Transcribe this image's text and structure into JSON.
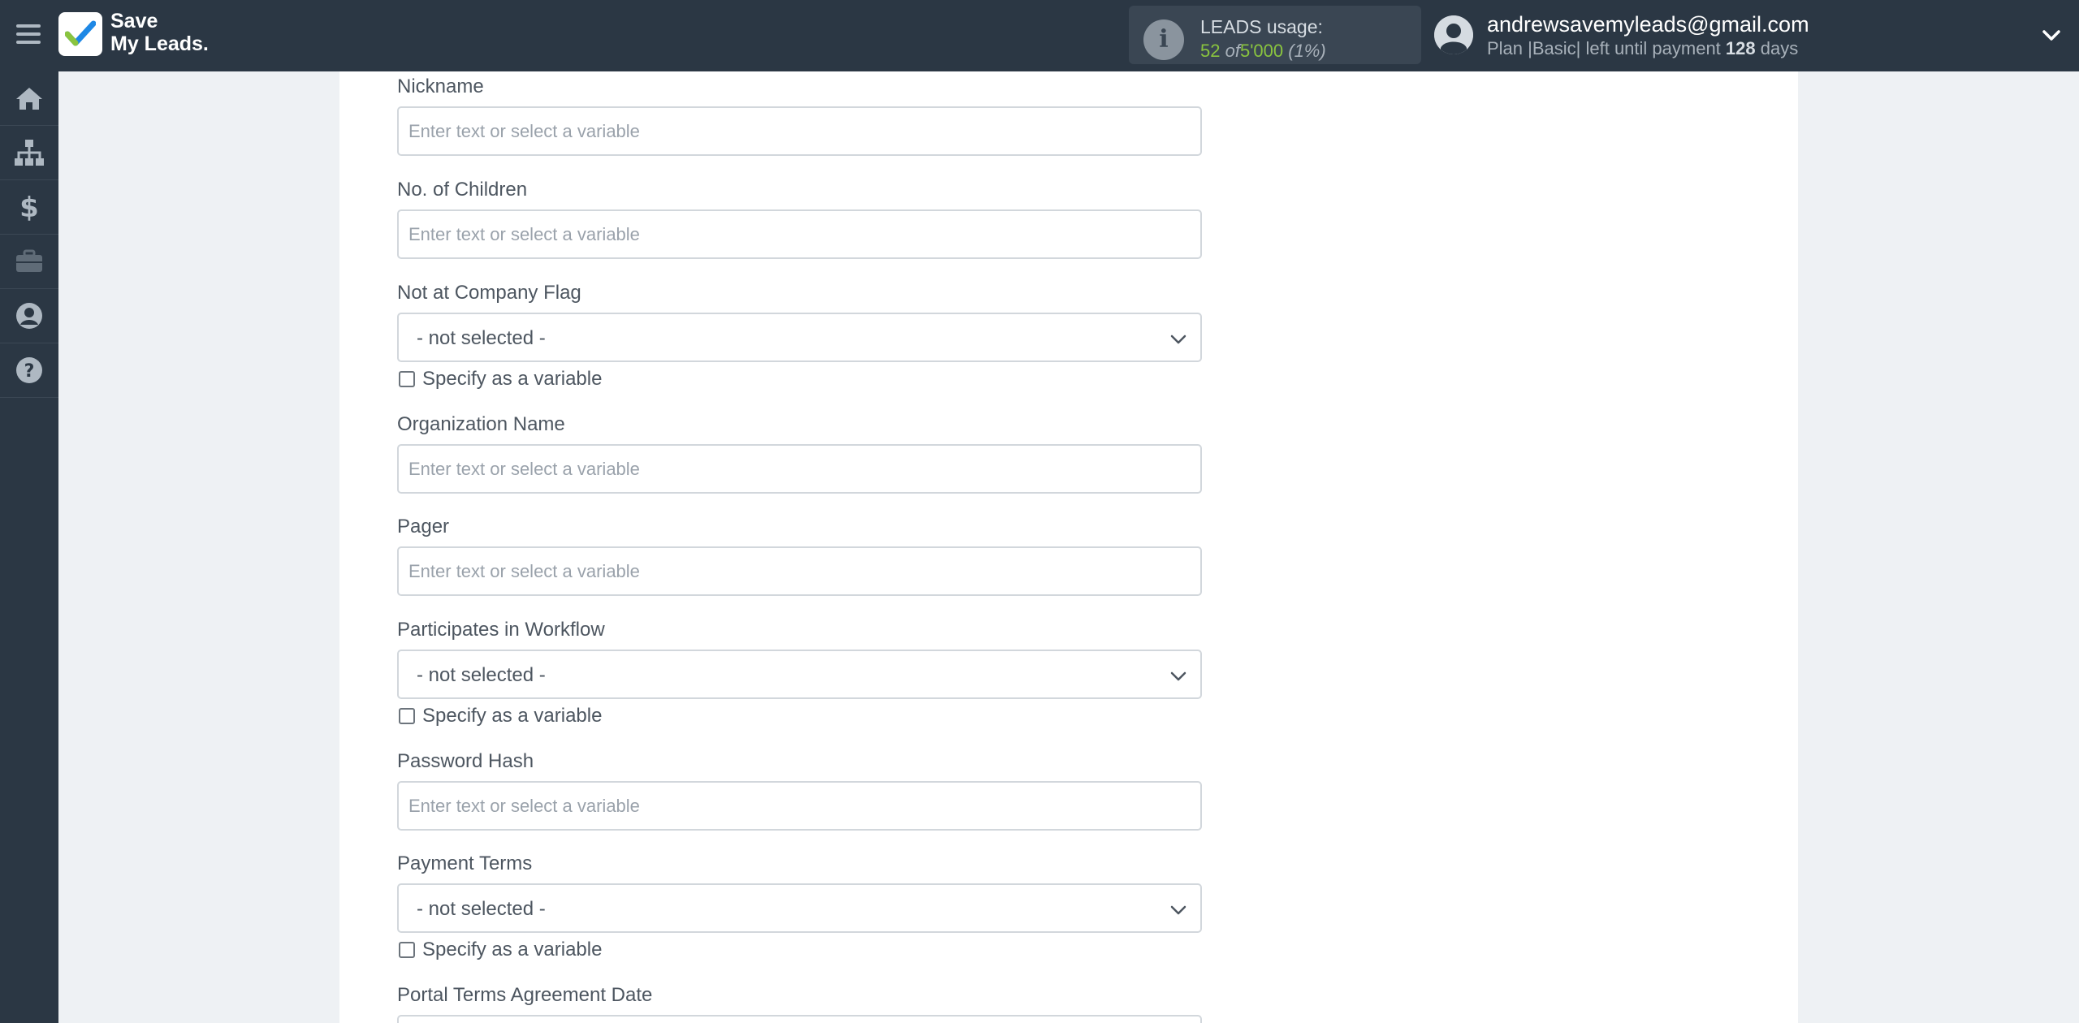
{
  "app": {
    "logo_line1": "Save",
    "logo_line2": "My Leads."
  },
  "usage": {
    "title": "LEADS usage:",
    "used": "52",
    "of": "of",
    "total": "5'000",
    "percent": "(1%)"
  },
  "user": {
    "email": "andrewsavemyleads@gmail.com",
    "plan_prefix": "Plan |Basic| left until payment",
    "days": "128",
    "days_suffix": "days"
  },
  "sidebar": {
    "items": [
      {
        "icon": "home-icon"
      },
      {
        "icon": "sitemap-icon"
      },
      {
        "icon": "dollar-icon"
      },
      {
        "icon": "briefcase-icon"
      },
      {
        "icon": "user-circle-icon"
      },
      {
        "icon": "question-circle-icon"
      }
    ]
  },
  "form": {
    "placeholder": "Enter text or select a variable",
    "not_selected": "- not selected -",
    "specify_variable": "Specify as a variable",
    "fields": {
      "nickname": "Nickname",
      "no_of_children": "No. of Children",
      "not_at_company_flag": "Not at Company Flag",
      "organization_name": "Organization Name",
      "pager": "Pager",
      "participates_in_workflow": "Participates in Workflow",
      "password_hash": "Password Hash",
      "payment_terms": "Payment Terms",
      "portal_terms_agreement_date": "Portal Terms Agreement Date"
    }
  },
  "colors": {
    "topbar": "#2b3744",
    "accent_green": "#8ac43f",
    "page_bg": "#eef1f4"
  }
}
